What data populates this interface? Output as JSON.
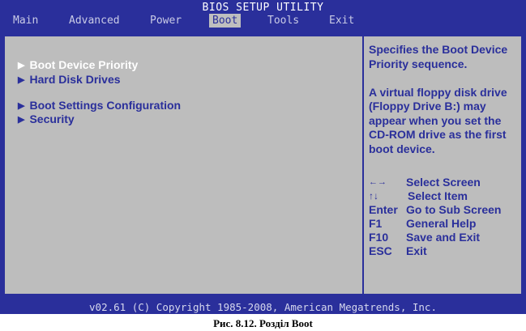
{
  "window": {
    "title": "BIOS SETUP UTILITY"
  },
  "menu": {
    "items": [
      {
        "label": "Main"
      },
      {
        "label": "Advanced"
      },
      {
        "label": "Power"
      },
      {
        "label": "Boot"
      },
      {
        "label": "Tools"
      },
      {
        "label": "Exit"
      }
    ],
    "active": "Boot"
  },
  "boot_menu": {
    "items": [
      {
        "label": "Boot Device Priority",
        "selected": true
      },
      {
        "label": "Hard Disk Drives",
        "selected": false
      },
      {
        "label": "Boot Settings Configuration",
        "selected": false
      },
      {
        "label": "Security",
        "selected": false
      }
    ]
  },
  "help": {
    "lines": [
      "Specifies the Boot Device",
      "Priority sequence.",
      "",
      "A virtual floppy disk drive",
      "(Floppy Drive B:) may",
      "appear when you set the",
      "CD-ROM drive as the first",
      "boot device."
    ]
  },
  "keys": [
    {
      "key": "←→",
      "desc": "Select Screen"
    },
    {
      "key": "↑↓",
      "desc": "Select Item"
    },
    {
      "key": "Enter",
      "desc": "Go to Sub Screen"
    },
    {
      "key": "F1",
      "desc": "General Help"
    },
    {
      "key": "F10",
      "desc": "Save and Exit"
    },
    {
      "key": "ESC",
      "desc": "Exit"
    }
  ],
  "footer": {
    "text": "v02.61 (C) Copyright 1985-2008, American Megatrends, Inc."
  },
  "caption": {
    "text": "Рис. 8.12. Розділ Boot"
  },
  "colors": {
    "bios_blue": "#2a2f9b",
    "panel_gray": "#bdbdbd",
    "selected_text": "#ffffff"
  }
}
